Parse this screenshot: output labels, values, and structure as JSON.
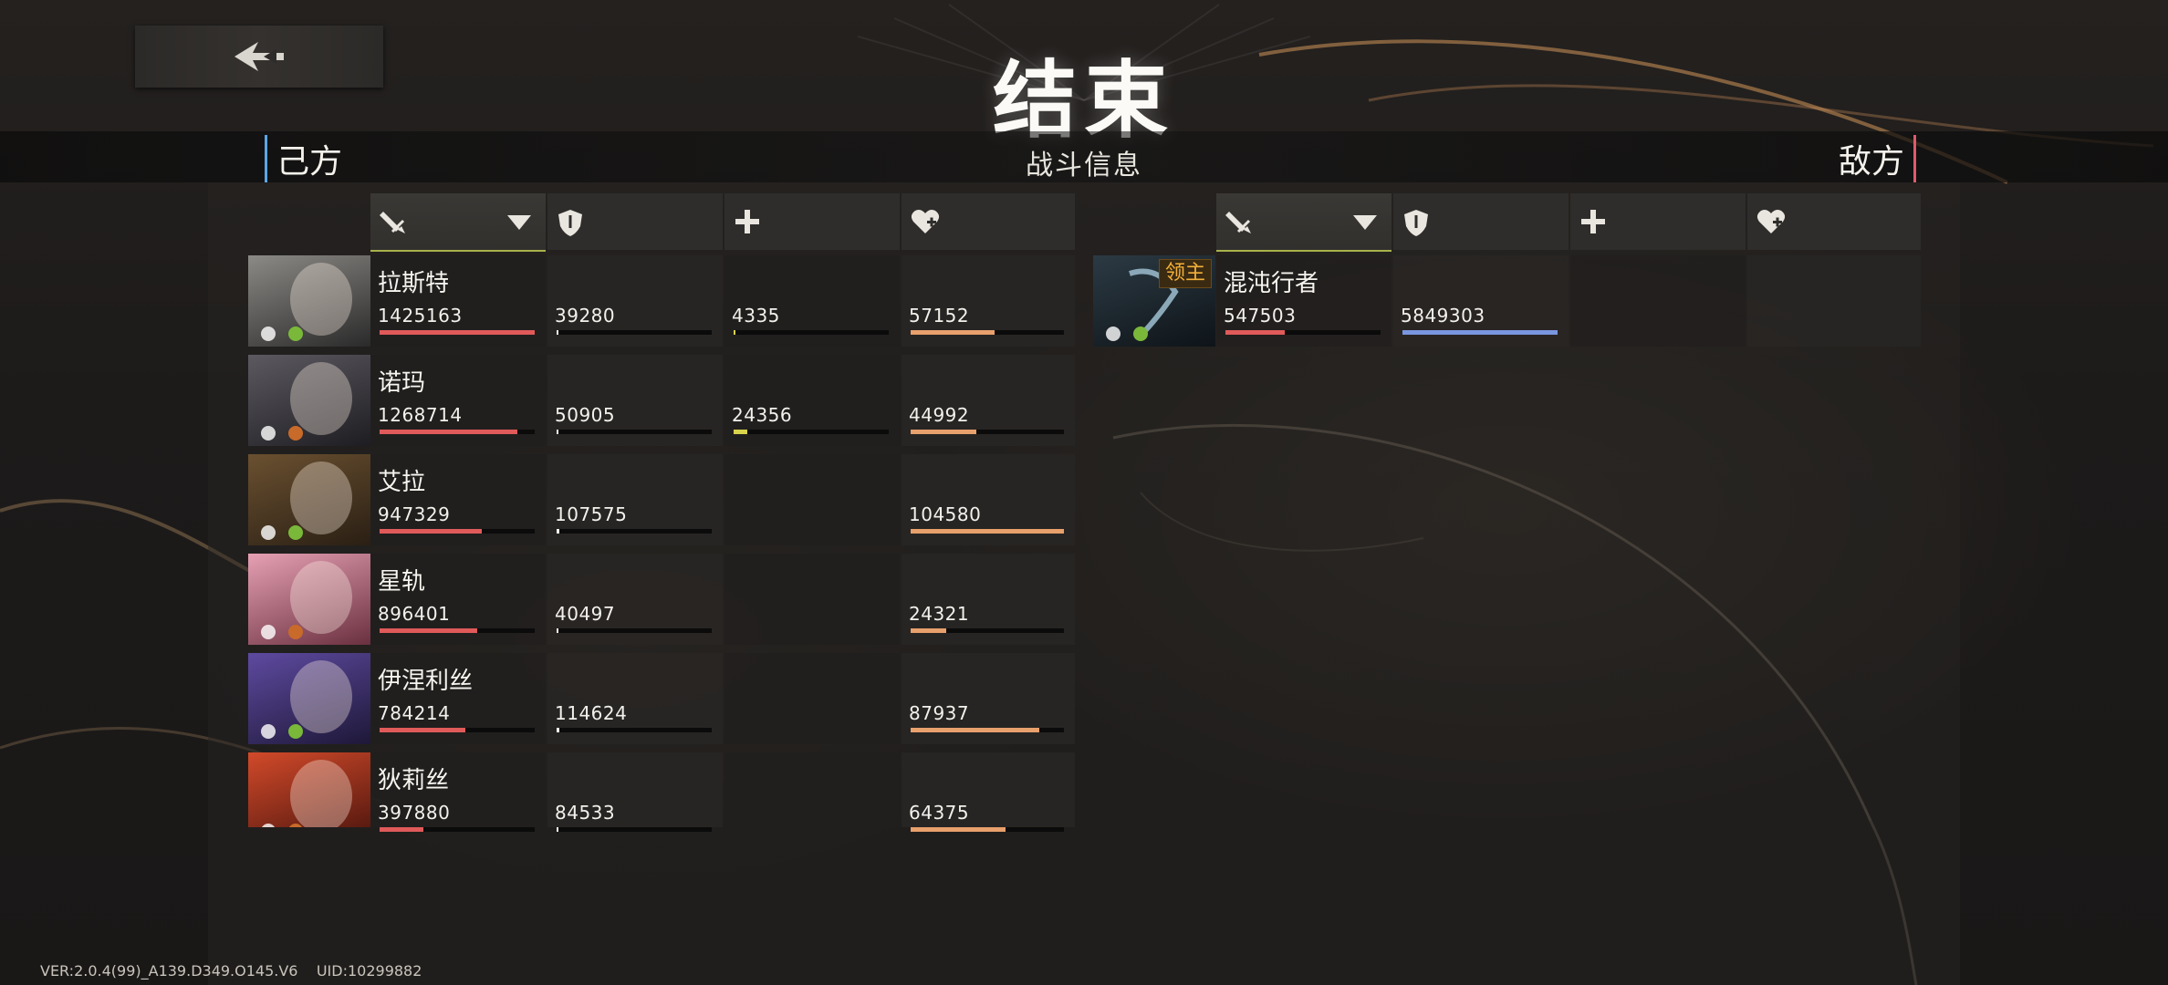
{
  "title": "结束",
  "center_label": "战斗信息",
  "ally_label": "己方",
  "enemy_label": "敌方",
  "column_icons": [
    "sword-icon",
    "shield-icon",
    "plus-icon",
    "heart-plus-icon"
  ],
  "version_text": "VER:2.0.4(99)_A139.D349.O145.V6",
  "uid_text": "UID:10299882",
  "colors": {
    "damage": "#e05a5a",
    "taken": "#f3f1ec",
    "heal": "#d8d24c",
    "recv": "#e8a06c",
    "boss_taken": "#7a96e0",
    "accent": "#a9b24a"
  },
  "allies": [
    {
      "name": "拉斯特",
      "damage": "1425163",
      "taken": "39280",
      "heal": "4335",
      "received": "57152",
      "damage_fill": 1.0,
      "taken_fill": 0.01,
      "heal_fill": 0.01,
      "received_fill": 0.55
    },
    {
      "name": "诺玛",
      "damage": "1268714",
      "taken": "50905",
      "heal": "24356",
      "received": "44992",
      "damage_fill": 0.89,
      "taken_fill": 0.01,
      "heal_fill": 0.09,
      "received_fill": 0.43
    },
    {
      "name": "艾拉",
      "damage": "947329",
      "taken": "107575",
      "heal": "",
      "received": "104580",
      "damage_fill": 0.66,
      "taken_fill": 0.02,
      "heal_fill": 0,
      "received_fill": 1.0
    },
    {
      "name": "星轨",
      "damage": "896401",
      "taken": "40497",
      "heal": "",
      "received": "24321",
      "damage_fill": 0.63,
      "taken_fill": 0.01,
      "heal_fill": 0,
      "received_fill": 0.23
    },
    {
      "name": "伊涅利丝",
      "damage": "784214",
      "taken": "114624",
      "heal": "",
      "received": "87937",
      "damage_fill": 0.55,
      "taken_fill": 0.02,
      "heal_fill": 0,
      "received_fill": 0.84
    },
    {
      "name": "狄莉丝",
      "damage": "397880",
      "taken": "84533",
      "heal": "",
      "received": "64375",
      "damage_fill": 0.28,
      "taken_fill": 0.01,
      "heal_fill": 0,
      "received_fill": 0.62
    }
  ],
  "enemies": [
    {
      "name": "混沌行者",
      "badge": "领主",
      "damage": "547503",
      "taken": "5849303",
      "damage_fill": 0.38,
      "taken_fill": 1.0
    }
  ]
}
